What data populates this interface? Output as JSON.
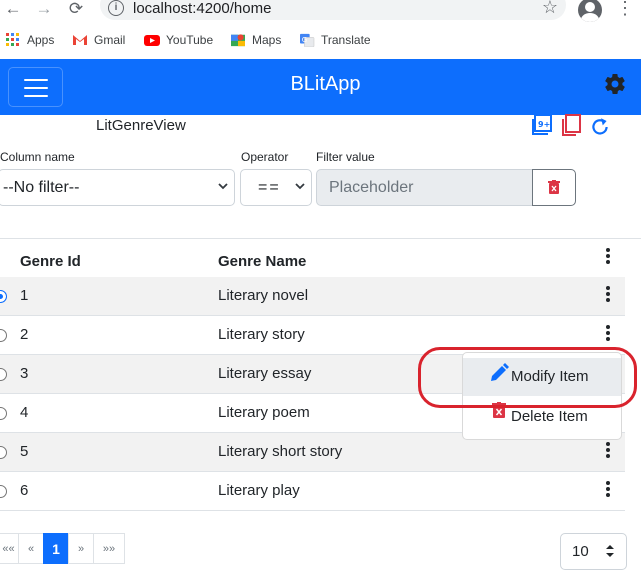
{
  "browser": {
    "url": "localhost:4200/home",
    "nav": {
      "back": "←",
      "forward": "→",
      "reload": "⟳"
    },
    "bookmarks": [
      {
        "label": "Apps",
        "icon": "apps-grid-icon"
      },
      {
        "label": "Gmail",
        "icon": "gmail-icon"
      },
      {
        "label": "YouTube",
        "icon": "youtube-icon"
      },
      {
        "label": "Maps",
        "icon": "maps-icon"
      },
      {
        "label": "Translate",
        "icon": "translate-icon"
      }
    ]
  },
  "navbar": {
    "brand": "BLitApp",
    "color": "#0d6efd"
  },
  "view": {
    "title": "LitGenreView"
  },
  "filter": {
    "column_label": "Column name",
    "column_value": "--No filter--",
    "operator_label": "Operator",
    "operator_value": "==",
    "value_label": "Filter value",
    "value_placeholder": "Placeholder"
  },
  "table": {
    "headers": [
      "Genre Id",
      "Genre Name"
    ],
    "rows": [
      {
        "id": "1",
        "name": "Literary novel",
        "selected": true
      },
      {
        "id": "2",
        "name": "Literary story",
        "selected": false
      },
      {
        "id": "3",
        "name": "Literary essay",
        "selected": false
      },
      {
        "id": "4",
        "name": "Literary poem",
        "selected": false
      },
      {
        "id": "5",
        "name": "Literary short story",
        "selected": false
      },
      {
        "id": "6",
        "name": "Literary play",
        "selected": false
      }
    ]
  },
  "context_menu": {
    "items": [
      {
        "label": "Modify Item",
        "icon": "pencil-icon"
      },
      {
        "label": "Delete Item",
        "icon": "trash-icon"
      }
    ],
    "highlight_color": "#d9232d"
  },
  "pagination": {
    "first": "««",
    "prev": "«",
    "current": "1",
    "next": "»",
    "last": "»»",
    "page_size": "10"
  }
}
